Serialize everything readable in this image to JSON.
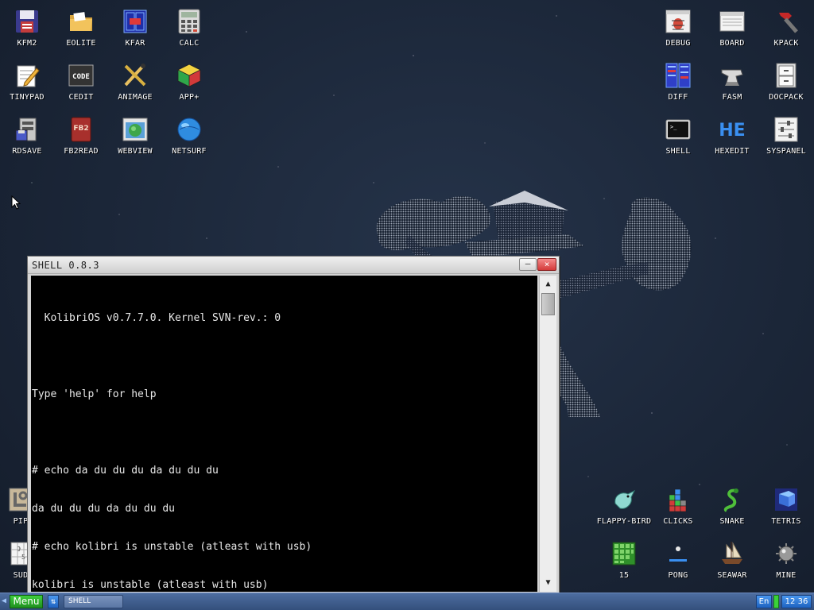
{
  "desktop": {
    "icons": [
      {
        "label": "KFM2",
        "icon": "floppy-icon"
      },
      {
        "label": "EOLITE",
        "icon": "folder-icon"
      },
      {
        "label": "KFAR",
        "icon": "file-manager-icon"
      },
      {
        "label": "CALC",
        "icon": "calculator-icon"
      },
      {
        "label": "TINYPAD",
        "icon": "notepad-icon"
      },
      {
        "label": "CEDIT",
        "icon": "code-editor-icon"
      },
      {
        "label": "ANIMAGE",
        "icon": "paint-icon"
      },
      {
        "label": "APP+",
        "icon": "cube-icon"
      },
      {
        "label": "RDSAVE",
        "icon": "ramdisk-save-icon"
      },
      {
        "label": "FB2READ",
        "icon": "book-icon"
      },
      {
        "label": "WEBVIEW",
        "icon": "browser-icon"
      },
      {
        "label": "NETSURF",
        "icon": "globe-icon"
      },
      {
        "label": "DEBUG",
        "icon": "bug-icon"
      },
      {
        "label": "BOARD",
        "icon": "board-icon"
      },
      {
        "label": "KPACK",
        "icon": "hammer-icon"
      },
      {
        "label": "DIFF",
        "icon": "diff-icon"
      },
      {
        "label": "FASM",
        "icon": "anvil-icon"
      },
      {
        "label": "DOCPACK",
        "icon": "cabinet-icon"
      },
      {
        "label": "SHELL",
        "icon": "terminal-icon"
      },
      {
        "label": "HEXEDIT",
        "icon": "hex-icon",
        "text": "HE"
      },
      {
        "label": "SYSPANEL",
        "icon": "sliders-icon"
      },
      {
        "label": "PIP",
        "icon": "pipes-icon"
      },
      {
        "label": "SUD",
        "icon": "sudoku-icon"
      },
      {
        "label": "FLAPPY-BIRD",
        "icon": "bird-icon"
      },
      {
        "label": "CLICKS",
        "icon": "blocks-icon"
      },
      {
        "label": "SNAKE",
        "icon": "snake-icon"
      },
      {
        "label": "TETRIS",
        "icon": "tetris-icon"
      },
      {
        "label": "15",
        "icon": "grid-puzzle-icon"
      },
      {
        "label": "PONG",
        "icon": "pong-icon"
      },
      {
        "label": "SEAWAR",
        "icon": "ship-icon"
      },
      {
        "label": "MINE",
        "icon": "mine-icon"
      }
    ]
  },
  "window": {
    "title": "SHELL 0.8.3",
    "minimize_label": "–",
    "close_label": "×",
    "scroll_up": "▲",
    "scroll_down": "▼",
    "console": {
      "lines": [
        "  KolibriOS v0.7.7.0. Kernel SVN-rev.: 0",
        "",
        "Type 'help' for help",
        "",
        "# echo da du du du da du du du",
        "da du du du da du du du",
        "# echo kolibri is unstable (atleast with usb)",
        "kolibri is unstable (atleast with usb)"
      ],
      "prompt": "# "
    }
  },
  "taskbar": {
    "menu_label": "Menu",
    "swap_label": "⇅",
    "task_label": "SHELL",
    "lang": "En",
    "time": "12 36"
  },
  "colors": {
    "desktop_bg": "#1b2638",
    "taskbar": "#34507c",
    "menu_green": "#2aa82a"
  }
}
